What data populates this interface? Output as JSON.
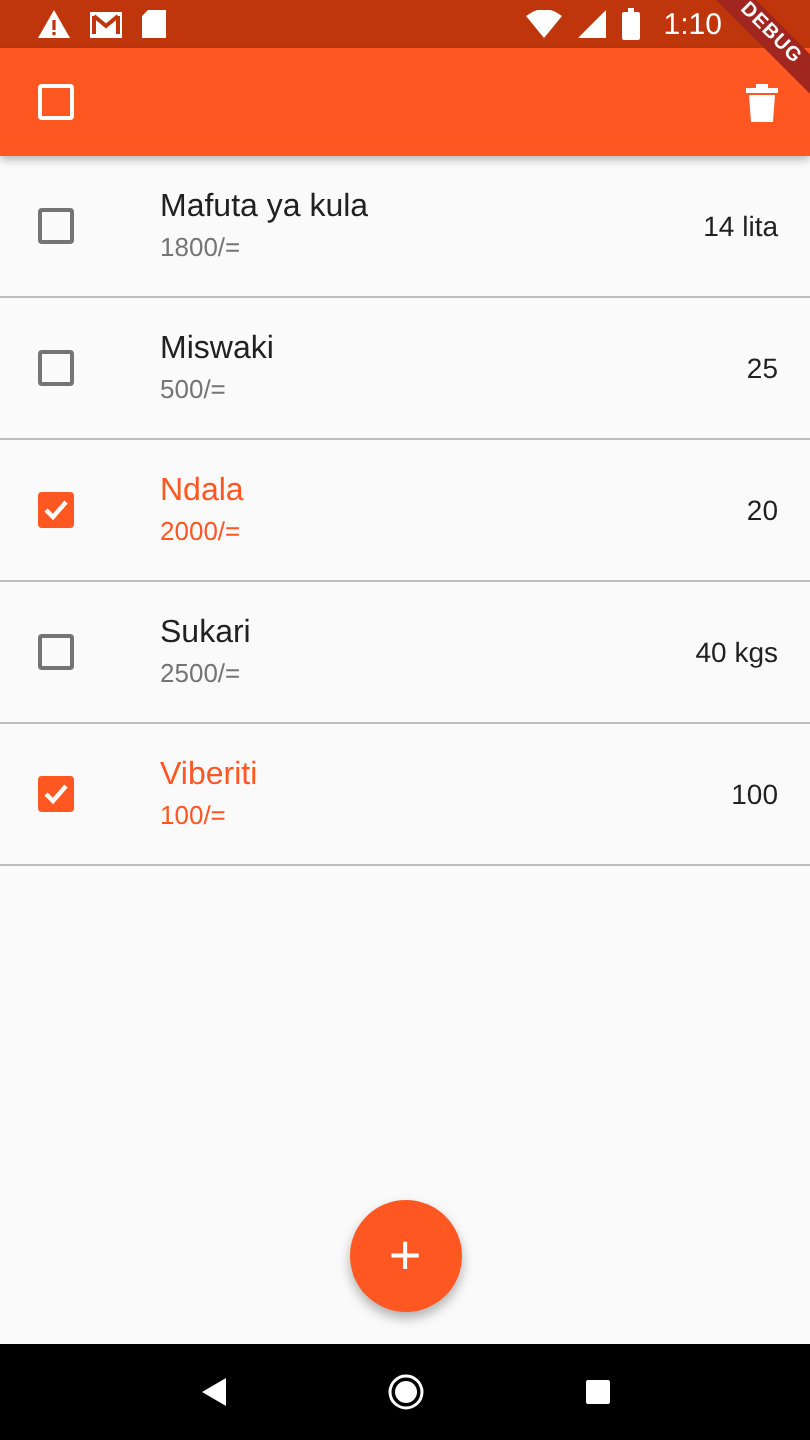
{
  "status_bar": {
    "time": "1:10"
  },
  "app_bar": {
    "select_all": {
      "checked": false
    }
  },
  "debug_banner": "DEBUG",
  "items": [
    {
      "name": "Mafuta ya kula",
      "price": "1800/=",
      "quantity": "14 lita",
      "checked": false
    },
    {
      "name": "Miswaki",
      "price": "500/=",
      "quantity": "25",
      "checked": false
    },
    {
      "name": "Ndala",
      "price": "2000/=",
      "quantity": "20",
      "checked": true
    },
    {
      "name": "Sukari",
      "price": "2500/=",
      "quantity": "40 kgs",
      "checked": false
    },
    {
      "name": "Viberiti",
      "price": "100/=",
      "quantity": "100",
      "checked": true
    }
  ],
  "fab": {
    "label": "+"
  }
}
